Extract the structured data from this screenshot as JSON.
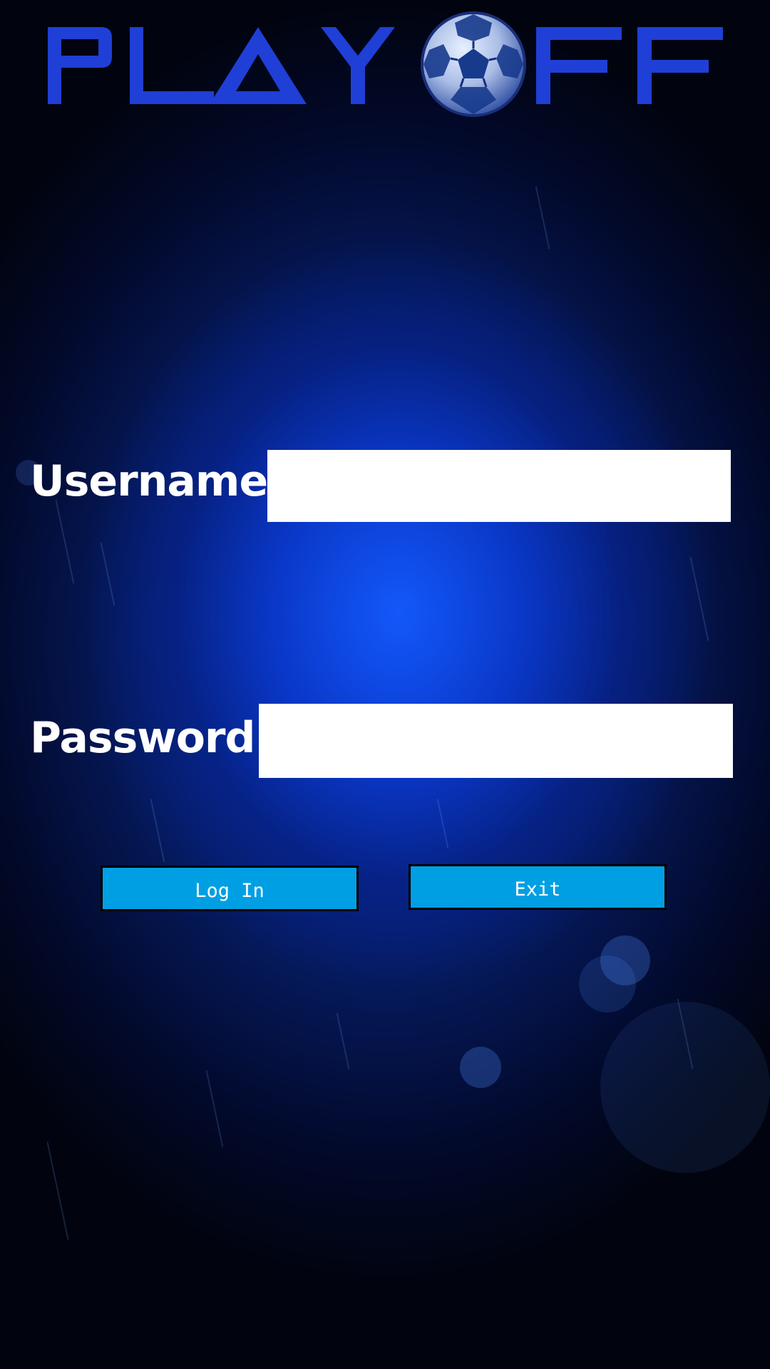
{
  "app": {
    "logo_text_left": "PLAY",
    "logo_text_right": "FF"
  },
  "form": {
    "username_label": "Username",
    "username_value": "",
    "password_label": "Password",
    "password_value": "",
    "login_label": "Log In",
    "exit_label": "Exit"
  },
  "colors": {
    "logo_blue": "#1f3fd6",
    "button_blue": "#009fe3",
    "background_blue": "#0a2f9e"
  },
  "icons": {
    "logo_ball": "soccer-ball-icon"
  }
}
